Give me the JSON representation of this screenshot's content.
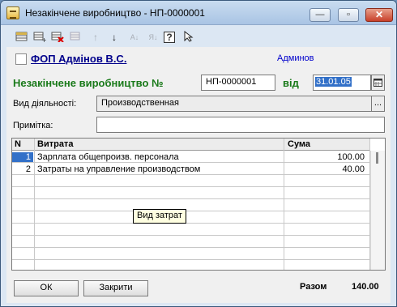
{
  "window": {
    "title": "Незакінчене виробництво - НП-0000001",
    "min_glyph": "—",
    "max_glyph": "▫",
    "close_glyph": "✕"
  },
  "toolbar": {
    "icons": [
      "new-record-icon",
      "copy-record-icon",
      "delete-record-icon",
      "edit-record-icon",
      "move-up-icon",
      "move-down-icon",
      "sort-ascending-icon",
      "sort-descending-icon",
      "help-icon",
      "select-cursor-icon"
    ],
    "up_glyph": "↑",
    "down_glyph": "↓",
    "sort_asc_glyph": "A↓",
    "sort_desc_glyph": "Я↓",
    "help_glyph": "?"
  },
  "header": {
    "organization": "ФОП Адмінов В.С.",
    "user": "Админов",
    "doc_title": "Незакінчене виробництво №",
    "doc_number": "НП-0000001",
    "date_label": "від",
    "date_value": "31.01.05"
  },
  "fields": {
    "activity_label": "Вид діяльності:",
    "activity_value": "Производственная",
    "note_label": "Примітка:",
    "note_value": "",
    "ellipsis": "..."
  },
  "table": {
    "columns": [
      "N",
      "Витрата",
      "Сума"
    ],
    "rows": [
      {
        "n": "1",
        "name": "Зарплата общепроизв. персонала",
        "sum": "100.00"
      },
      {
        "n": "2",
        "name": "Затраты на управление производством",
        "sum": "40.00"
      }
    ],
    "tooltip": "Вид затрат"
  },
  "footer": {
    "ok_label": "ОК",
    "close_label": "Закрити",
    "total_label": "Разом",
    "total_value": "140.00"
  },
  "colors": {
    "accent": "#3270c8",
    "title_green": "#1a7a1a",
    "org_blue": "#00008b"
  }
}
